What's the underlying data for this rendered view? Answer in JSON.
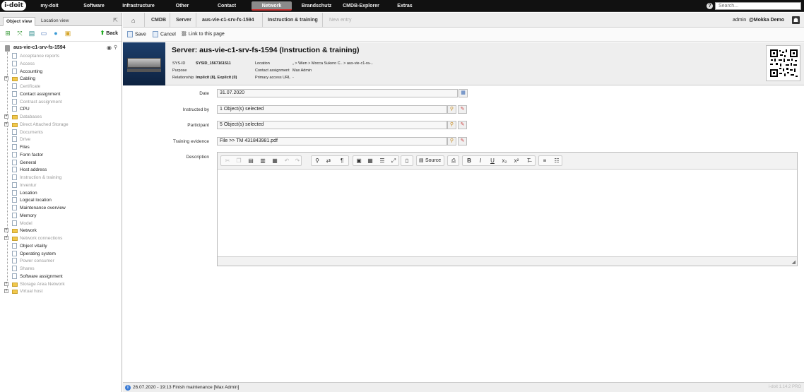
{
  "app": {
    "logo_text": "i-doit",
    "search_placeholder": "Search...",
    "version": "i-doit 1.14.2 PRO"
  },
  "topnav": [
    {
      "label": "my-doit",
      "active": false
    },
    {
      "label": "Software",
      "active": false
    },
    {
      "label": "Infrastructure",
      "active": false
    },
    {
      "label": "Other",
      "active": false
    },
    {
      "label": "Contact",
      "active": false
    },
    {
      "label": "Network",
      "active": true
    },
    {
      "label": "Brandschutz",
      "active": false
    },
    {
      "label": "CMDB-Explorer",
      "active": false
    },
    {
      "label": "Extras",
      "active": false
    }
  ],
  "left": {
    "tabs": [
      "Object view",
      "Location view"
    ],
    "back_label": "Back",
    "root_label": "aus-vie-c1-srv-fs-1594",
    "tree": [
      {
        "label": "Acceptance reports",
        "type": "doc",
        "dim": true,
        "expand": false
      },
      {
        "label": "Access",
        "type": "doc",
        "dim": true,
        "expand": false
      },
      {
        "label": "Accounting",
        "type": "doc",
        "dim": false,
        "expand": false
      },
      {
        "label": "Cabling",
        "type": "folder",
        "dim": false,
        "expand": true
      },
      {
        "label": "Certificate",
        "type": "doc",
        "dim": true,
        "expand": false
      },
      {
        "label": "Contact assignment",
        "type": "doc",
        "dim": false,
        "expand": false
      },
      {
        "label": "Contract assignment",
        "type": "doc",
        "dim": true,
        "expand": false
      },
      {
        "label": "CPU",
        "type": "doc",
        "dim": false,
        "expand": false
      },
      {
        "label": "Databases",
        "type": "folder",
        "dim": true,
        "expand": true
      },
      {
        "label": "Direct Attached Storage",
        "type": "folder",
        "dim": true,
        "expand": true
      },
      {
        "label": "Documents",
        "type": "doc",
        "dim": true,
        "expand": false
      },
      {
        "label": "Drive",
        "type": "doc",
        "dim": true,
        "expand": false
      },
      {
        "label": "Files",
        "type": "doc",
        "dim": false,
        "expand": false
      },
      {
        "label": "Form factor",
        "type": "doc",
        "dim": false,
        "expand": false
      },
      {
        "label": "General",
        "type": "doc",
        "dim": false,
        "expand": false
      },
      {
        "label": "Host address",
        "type": "doc",
        "dim": false,
        "expand": false
      },
      {
        "label": "Instruction & training",
        "type": "doc",
        "dim": true,
        "expand": false
      },
      {
        "label": "Inventur",
        "type": "doc",
        "dim": true,
        "expand": false
      },
      {
        "label": "Location",
        "type": "doc",
        "dim": false,
        "expand": false
      },
      {
        "label": "Logical location",
        "type": "doc",
        "dim": false,
        "expand": false
      },
      {
        "label": "Maintenance overview",
        "type": "doc",
        "dim": false,
        "expand": false
      },
      {
        "label": "Memory",
        "type": "doc",
        "dim": false,
        "expand": false
      },
      {
        "label": "Model",
        "type": "doc",
        "dim": true,
        "expand": false
      },
      {
        "label": "Network",
        "type": "folder",
        "dim": false,
        "expand": true
      },
      {
        "label": "Network connections",
        "type": "folder",
        "dim": true,
        "expand": true
      },
      {
        "label": "Object vitality",
        "type": "doc",
        "dim": false,
        "expand": false
      },
      {
        "label": "Operating system",
        "type": "doc",
        "dim": false,
        "expand": false
      },
      {
        "label": "Power consumer",
        "type": "doc",
        "dim": true,
        "expand": false
      },
      {
        "label": "Shares",
        "type": "doc",
        "dim": true,
        "expand": false
      },
      {
        "label": "Software assignment",
        "type": "doc",
        "dim": false,
        "expand": false
      },
      {
        "label": "Storage Area Network",
        "type": "folder",
        "dim": true,
        "expand": true
      },
      {
        "label": "Virtual host",
        "type": "folder",
        "dim": true,
        "expand": true
      }
    ]
  },
  "breadcrumb": [
    "CMDB",
    "Server",
    "aus-vie-c1-srv-fs-1594",
    "Instruction & training",
    "New entry"
  ],
  "user": {
    "name": "admin",
    "tenant": "@Mokka Demo"
  },
  "actions": {
    "save": "Save",
    "cancel": "Cancel",
    "link": "Link to this page"
  },
  "object": {
    "title": "Server: aus-vie-c1-srv-fs-1594 (Instruction & training)",
    "sysid_label": "SYS-ID",
    "sysid": "SYSID_1567161511",
    "purpose_label": "Purpose",
    "purpose": "",
    "relationship_label": "Relationship",
    "relationship": "Implicit (8), Explicit (0)",
    "location_label": "Location",
    "location": "„ > Wien > Mocca Sukero C.. > aus-vie-c1-ra-..",
    "contact_label": "Contact assignment",
    "contact": "Max Admin",
    "primary_label": "Primary access URL",
    "primary": "-"
  },
  "form": {
    "date_label": "Date",
    "date_value": "31.07.2020",
    "instructed_label": "Instructed by",
    "instructed_value": "1 Object(s) selected",
    "participant_label": "Participant",
    "participant_value": "5 Object(s) selected",
    "evidence_label": "Training evidence",
    "evidence_value": "File >> TM 431843981.pdf",
    "description_label": "Description",
    "source_label": "Source"
  },
  "status": {
    "text": "26.07.2020 - 19:13 Finish maintenance [Max Admin]"
  }
}
